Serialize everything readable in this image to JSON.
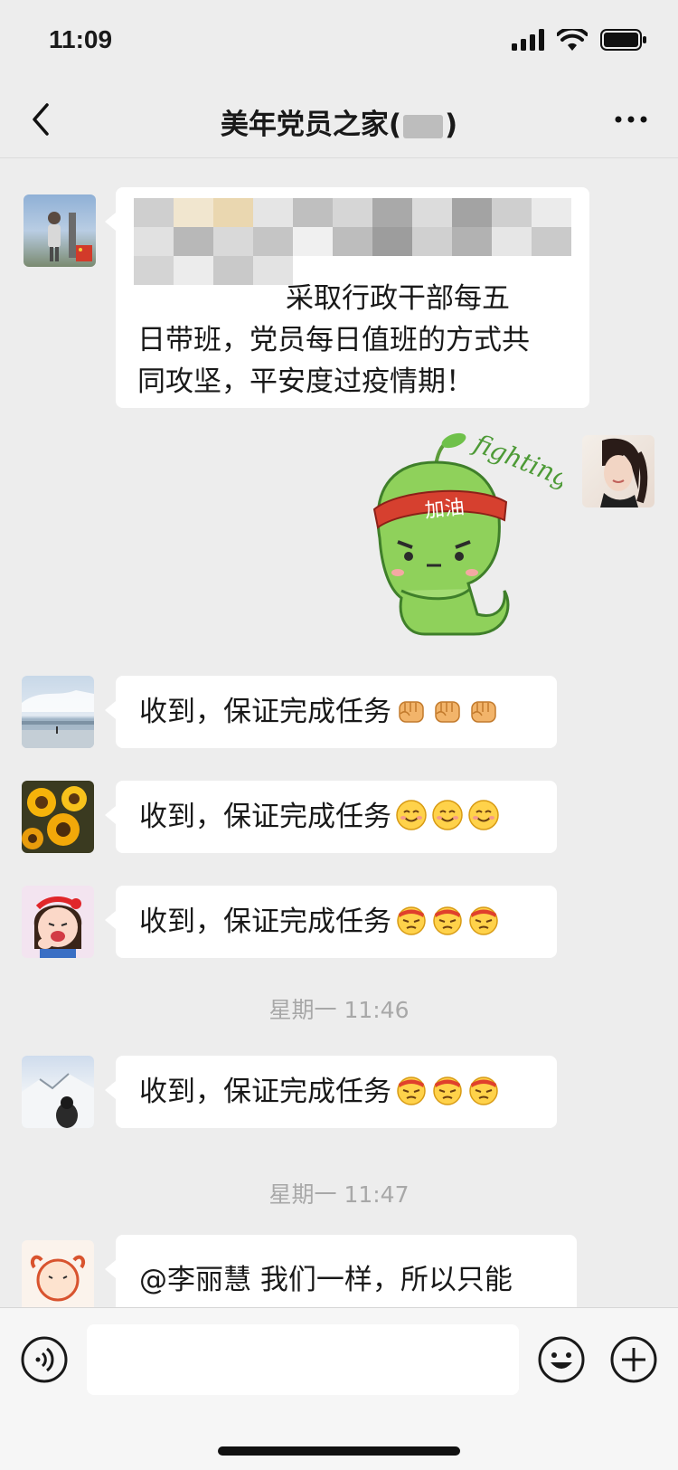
{
  "status_bar": {
    "time": "11:09"
  },
  "header": {
    "title_prefix": "美年党员之家(",
    "title_suffix": ")"
  },
  "messages": {
    "m1_text": "采取行政干部每五日带班，党员每日值班的方式共同攻坚，平安度过疫情期！",
    "sticker_band": "加油",
    "sticker_word": "fighting",
    "m3_text": "收到，保证完成任务",
    "m4_text": "收到，保证完成任务",
    "m5_text": "收到，保证完成任务",
    "ts1": "星期一 11:46",
    "m6_text": "收到，保证完成任务",
    "ts2": "星期一 11:47",
    "m7_text": "@李丽慧 我们一样，所以只能"
  },
  "colors": {
    "background": "#ededed",
    "bubble": "#ffffff",
    "sticker_green": "#8fd15b",
    "band_red": "#d6402f"
  }
}
